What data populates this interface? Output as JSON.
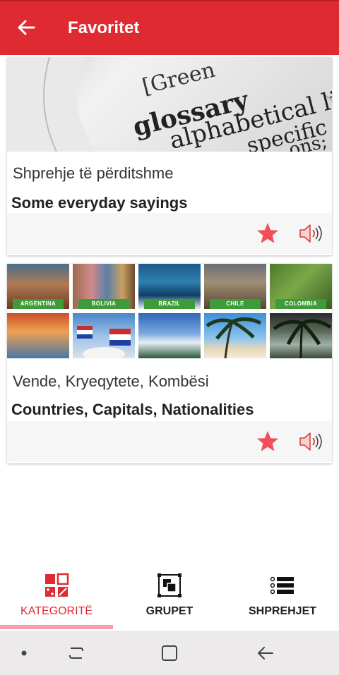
{
  "header": {
    "title": "Favoritet"
  },
  "cards": [
    {
      "image": {
        "words": [
          "[Green",
          "glossary",
          "alphabetical lis",
          "specific",
          "ons;"
        ]
      },
      "subtitle": "Shprehje të përditshme",
      "title": "Some everyday sayings",
      "favorite": true
    },
    {
      "image": {
        "countries": [
          "ARGENTINA",
          "BOLIVIA",
          "BRAZIL",
          "CHILE",
          "COLOMBIA"
        ]
      },
      "subtitle": "Vende, Kryeqytete, Kombësi",
      "title": "Countries, Capitals, Nationalities",
      "favorite": true
    }
  ],
  "bottom_nav": {
    "items": [
      {
        "label": "KATEGORITË",
        "active": true
      },
      {
        "label": "GRUPET",
        "active": false
      },
      {
        "label": "SHPREHJET",
        "active": false
      }
    ]
  },
  "colors": {
    "accent": "#e02a32",
    "star": "#f0505a",
    "speaker": "#d83a3a",
    "tag_green": "#3f9a3a"
  }
}
